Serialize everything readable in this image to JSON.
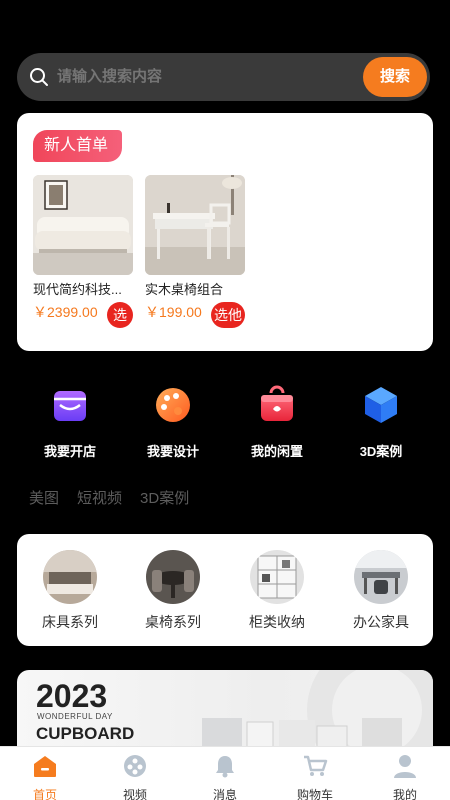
{
  "search": {
    "placeholder": "请输入搜索内容",
    "button": "搜索"
  },
  "new_user": {
    "tag": "新人首单",
    "products": [
      {
        "name": "现代简约科技...",
        "price": "￥2399.00",
        "action": "选"
      },
      {
        "name": "实木桌椅组合",
        "price": "￥199.00",
        "action": "选他"
      }
    ]
  },
  "quick_links": [
    {
      "label": "我要开店",
      "icon": "shop-icon"
    },
    {
      "label": "我要设计",
      "icon": "palette-icon"
    },
    {
      "label": "我的闲置",
      "icon": "gift-box-icon"
    },
    {
      "label": "3D案例",
      "icon": "cube-icon"
    }
  ],
  "tabs": [
    "美图",
    "短视频",
    "3D案例"
  ],
  "categories": [
    {
      "label": "床具系列"
    },
    {
      "label": "桌椅系列"
    },
    {
      "label": "柜类收纳"
    },
    {
      "label": "办公家具"
    }
  ],
  "banner": {
    "year": "2023",
    "subtitle": "WONDERFUL DAY",
    "title": "CUPBOARD"
  },
  "bottom_nav": [
    {
      "label": "首页",
      "icon": "home-icon",
      "active": true
    },
    {
      "label": "视频",
      "icon": "video-icon",
      "active": false
    },
    {
      "label": "消息",
      "icon": "bell-icon",
      "active": false
    },
    {
      "label": "购物车",
      "icon": "cart-icon",
      "active": false
    },
    {
      "label": "我的",
      "icon": "user-icon",
      "active": false
    }
  ],
  "colors": {
    "accent": "#f57c1f",
    "tag_red": "#f0465a",
    "buy_red": "#e8251f",
    "background": "#000000"
  }
}
